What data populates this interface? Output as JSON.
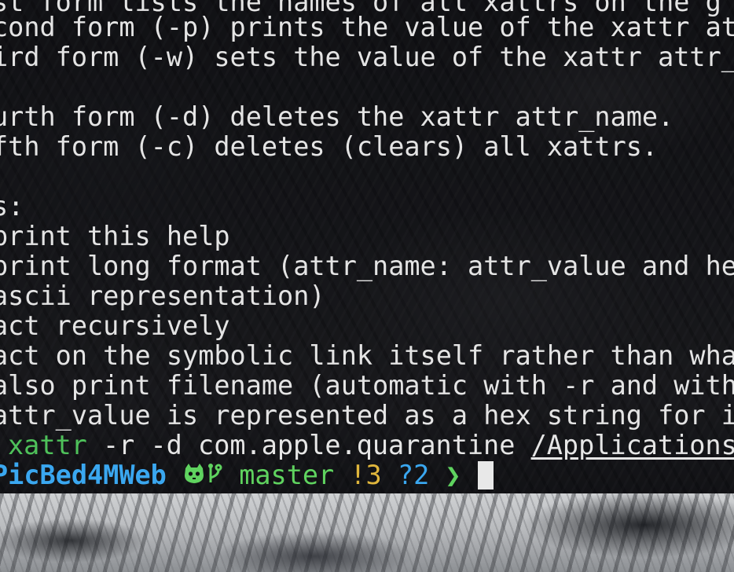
{
  "terminal": {
    "help_lines": [
      "st form lists the names of all xattrs on the g",
      "cond form (-p) prints the value of the xattr att",
      "ird form (-w) sets the value of the xattr attr_n",
      "",
      "urth form (-d) deletes the xattr attr_name.",
      "fth form (-c) deletes (clears) all xattrs.",
      "",
      "s:",
      "print this help",
      "print long format (attr_name: attr_value and hex",
      "ascii representation)",
      "act recursively",
      "act on the symbolic link itself rather than what",
      "also print filename (automatic with -r and with",
      "attr_value is represented as a hex string for in"
    ],
    "command": {
      "program": "xattr",
      "args": " -r -d com.apple.quarantine ",
      "path": "/Applications/"
    },
    "prompt": {
      "directory": "PicBed4MWeb",
      "git_icon": "github-cat-icon",
      "branch_icon": "git-branch-icon",
      "branch": "master",
      "modified": "!3",
      "untracked": "?2",
      "arrow": "❯"
    }
  },
  "colors": {
    "command_green": "#4ec15a",
    "directory_blue": "#3aa7f0",
    "modified_yellow": "#e0b63c",
    "text": "#e4e4e4"
  }
}
